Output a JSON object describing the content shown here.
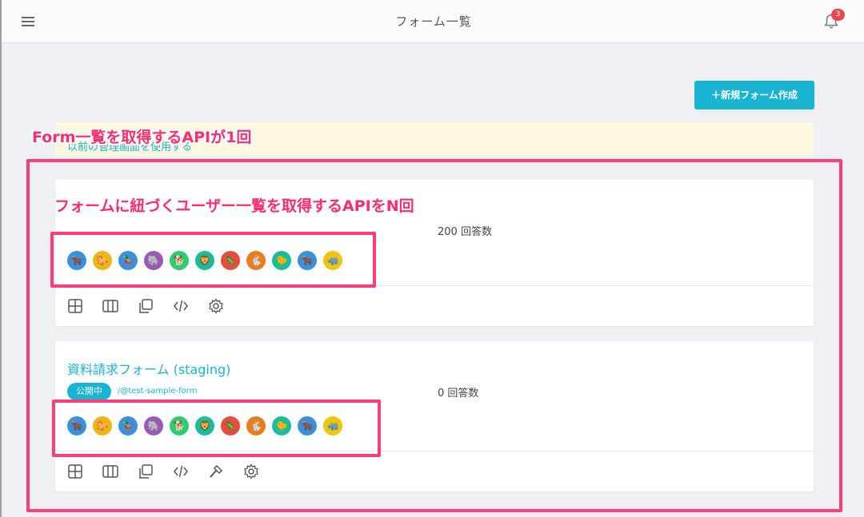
{
  "header": {
    "title": "フォーム一覧",
    "notification_count": "3"
  },
  "actions": {
    "new_form_label": "＋新規フォーム作成"
  },
  "notice": {
    "link_text": "以前の管理画面を使用する"
  },
  "forms": [
    {
      "title": "",
      "response_count": "200 回答数",
      "status": "",
      "slug": "",
      "tools": [
        "grid-icon",
        "columns-icon",
        "copy-icon",
        "code-icon",
        "settings-icon"
      ]
    },
    {
      "title": "資料請求フォーム (staging)",
      "response_count": "0 回答数",
      "status": "公開中",
      "slug": "/@test-sample-form",
      "tools": [
        "grid-icon",
        "columns-icon",
        "copy-icon",
        "code-icon",
        "hammer-icon",
        "settings-icon"
      ]
    }
  ],
  "avatars": [
    {
      "name": "bull-avatar",
      "color": "#3d8fd9",
      "glyph": "🐂"
    },
    {
      "name": "horse-avatar",
      "color": "#f2b414",
      "glyph": "🐎"
    },
    {
      "name": "duck-avatar",
      "color": "#3d8fd9",
      "glyph": "🦆"
    },
    {
      "name": "elephant-avatar",
      "color": "#9b59b6",
      "glyph": "🐘"
    },
    {
      "name": "dog-avatar",
      "color": "#2ecc71",
      "glyph": "🐕"
    },
    {
      "name": "lion-avatar",
      "color": "#1abc9c",
      "glyph": "🦁"
    },
    {
      "name": "lizard-avatar",
      "color": "#e74c3c",
      "glyph": "🦎"
    },
    {
      "name": "rabbit-avatar",
      "color": "#e67e22",
      "glyph": "🐇"
    },
    {
      "name": "chick-avatar",
      "color": "#1abc9c",
      "glyph": "🐤"
    },
    {
      "name": "bull2-avatar",
      "color": "#3d8fd9",
      "glyph": "🐂"
    },
    {
      "name": "rhino-avatar",
      "color": "#f2c40f",
      "glyph": "🦏"
    }
  ],
  "annotations": {
    "outer_label": "Form一覧を取得するAPIが1回",
    "inner_label": "フォームに紐づくユーザー一覧を取得するAPIをN回"
  },
  "colors": {
    "accent": "#1ab4d3",
    "annotation": "#ff3d79",
    "badge": "#e5484d"
  }
}
